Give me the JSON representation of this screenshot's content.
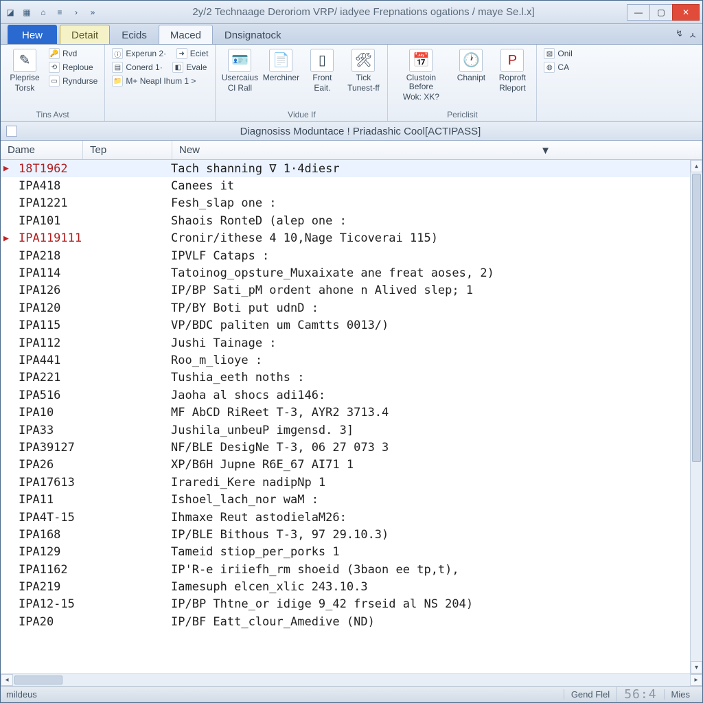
{
  "titlebar": {
    "title": "2y/2 Technaage Deroriom VRP/ iadyee  Frepnations ogations / maye Se.l.x]"
  },
  "tabs": {
    "file": "Hew",
    "items": [
      "Detait",
      "Ecids",
      "Maced",
      "Dnsignatock"
    ]
  },
  "ribbon": {
    "g1": {
      "big1a": "Pleprise",
      "big1b": "Torsk",
      "s1": "Rvd",
      "s2": "Reploue",
      "s3": "Ryndurse",
      "label": "Tins Avst"
    },
    "g2": {
      "s1": "Experun 2·",
      "s2": "Eciet",
      "s3": "Conerd 1·",
      "s4": "Evale",
      "s5": "M+ Neapl Ihum 1 >",
      "label": ""
    },
    "g3": {
      "b1a": "Usercaius",
      "b1b": "Cl Rall",
      "b2a": "Merchiner",
      "b2b": "",
      "b3a": "Front",
      "b3b": "Eait.",
      "b4a": "Tick",
      "b4b": "Tunest-ff",
      "label": "Vidue If"
    },
    "g4": {
      "b1a": "Clustoin Before",
      "b1b": "Wok: XK?",
      "b2a": "Chanipt",
      "b2b": "",
      "b3a": "Roproft",
      "b3b": "Rleport",
      "label": "Periclisit"
    },
    "g5": {
      "s1": "Onil",
      "s2": "CA"
    }
  },
  "panel": {
    "title": "Diagnosiss Moduntace ! Priadashic Cool[ACTIPASS]"
  },
  "columns": {
    "c1": "Dame",
    "c2": "Tep",
    "c3": "New"
  },
  "rows": [
    {
      "mk": true,
      "code": "18T1962",
      "red": true,
      "desc": "Tach shanning   ∇  1·4diesr",
      "sel": true
    },
    {
      "mk": false,
      "code": "IPA418",
      "red": false,
      "desc": "Canees it"
    },
    {
      "mk": false,
      "code": "IPA1221",
      "red": false,
      "desc": "Fesh_slap one :"
    },
    {
      "mk": false,
      "code": "IPA101",
      "red": false,
      "desc": "Shaois RonteD (alep one :"
    },
    {
      "mk": true,
      "code": "IPA119111",
      "red": true,
      "desc": "Cronir/ithese   4 10,Nage Ticoverai 115)"
    },
    {
      "mk": false,
      "code": "IPA218",
      "red": false,
      "desc": "IPVLF Cataps :"
    },
    {
      "mk": false,
      "code": "IPA114",
      "red": false,
      "desc": "Tatoinog_opsture_Muxaixate ane freat aoses, 2)"
    },
    {
      "mk": false,
      "code": "IPA126",
      "red": false,
      "desc": "IP/BP Sati_pM ordent ahone n Alived slep; 1"
    },
    {
      "mk": false,
      "code": "IPA120",
      "red": false,
      "desc": "TP/BY Boti put udnD :"
    },
    {
      "mk": false,
      "code": "IPA115",
      "red": false,
      "desc": "VP/BDC paliten um Camtts 0013/)"
    },
    {
      "mk": false,
      "code": "IPA112",
      "red": false,
      "desc": "Jushi Tainage :"
    },
    {
      "mk": false,
      "code": "IPA441",
      "red": false,
      "desc": "Roo_m_lioye :"
    },
    {
      "mk": false,
      "code": "IPA221",
      "red": false,
      "desc": "Tushia_eeth noths :"
    },
    {
      "mk": false,
      "code": "IPA516",
      "red": false,
      "desc": "Jaoha al shocs adi146:"
    },
    {
      "mk": false,
      "code": "IPA10",
      "red": false,
      "desc": "MF AbCD RiReet T-3, AYR2 3713.4"
    },
    {
      "mk": false,
      "code": "IPA33",
      "red": false,
      "desc": "Jushila_unbeuP imgensd. 3]"
    },
    {
      "mk": false,
      "code": "IPA39127",
      "red": false,
      "desc": "NF/BLE DesigNe T-3, 06 27 073 3"
    },
    {
      "mk": false,
      "code": "IPA26",
      "red": false,
      "desc": "XP/B6H Jupne R6E_67 AI71 1"
    },
    {
      "mk": false,
      "code": "IPA17613",
      "red": false,
      "desc": "Iraredi_Kere nadipNp 1"
    },
    {
      "mk": false,
      "code": "IPA11",
      "red": false,
      "desc": "Ishoel_lach_nor waM :"
    },
    {
      "mk": false,
      "code": "IPA4T-15",
      "red": false,
      "desc": "Ihmaxe Reut astodielaM26:"
    },
    {
      "mk": false,
      "code": "IPA168",
      "red": false,
      "desc": "IP/BLE Bithous T-3, 97 29.10.3)"
    },
    {
      "mk": false,
      "code": "IPA129",
      "red": false,
      "desc": "Tameid stiop_per_porks 1"
    },
    {
      "mk": false,
      "code": "IPA1162",
      "red": false,
      "desc": "IP'R-e iriiefh_rm shoeid (3baon ee tp,t),"
    },
    {
      "mk": false,
      "code": "IPA219",
      "red": false,
      "desc": "Iamesuph elcen_xlic 243.10.3"
    },
    {
      "mk": false,
      "code": "IPA12-15",
      "red": false,
      "desc": "IP/BP Thtne_or idige 9_42 frseid al NS 204)"
    },
    {
      "mk": false,
      "code": "IPA20",
      "red": false,
      "desc": "IP/BF Eatt_clour_Amedive (ND)"
    }
  ],
  "status": {
    "left": "mildeus",
    "c1": "Gend Flel",
    "c2": "56:4",
    "c3": "Mies"
  }
}
